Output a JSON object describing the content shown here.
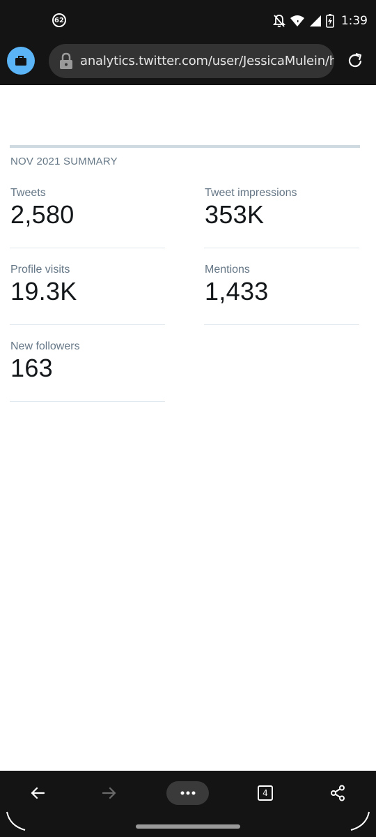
{
  "status_bar": {
    "notification_count": "62",
    "time": "1:39"
  },
  "browser": {
    "url": "analytics.twitter.com/user/JessicaMulein/home",
    "tab_count": "4"
  },
  "summary": {
    "title": "NOV 2021 SUMMARY",
    "metrics": [
      {
        "label": "Tweets",
        "value": "2,580"
      },
      {
        "label": "Tweet impressions",
        "value": "353K"
      },
      {
        "label": "Profile visits",
        "value": "19.3K"
      },
      {
        "label": "Mentions",
        "value": "1,433"
      },
      {
        "label": "New followers",
        "value": "163"
      }
    ]
  },
  "colors": {
    "chrome_background": "#141414",
    "url_pill": "#333333",
    "tab_badge": "#5ab4f5",
    "label_gray": "#657786",
    "value_black": "#14171a"
  },
  "icons": {
    "status": [
      "notification-badge",
      "bell-off-icon",
      "wifi-icon",
      "signal-icon",
      "battery-charging-icon"
    ],
    "browser": [
      "briefcase-icon",
      "lock-icon",
      "reload-icon"
    ],
    "nav": [
      "back-arrow-icon",
      "forward-arrow-icon",
      "more-dots-icon",
      "tabs-icon",
      "share-icon"
    ]
  }
}
